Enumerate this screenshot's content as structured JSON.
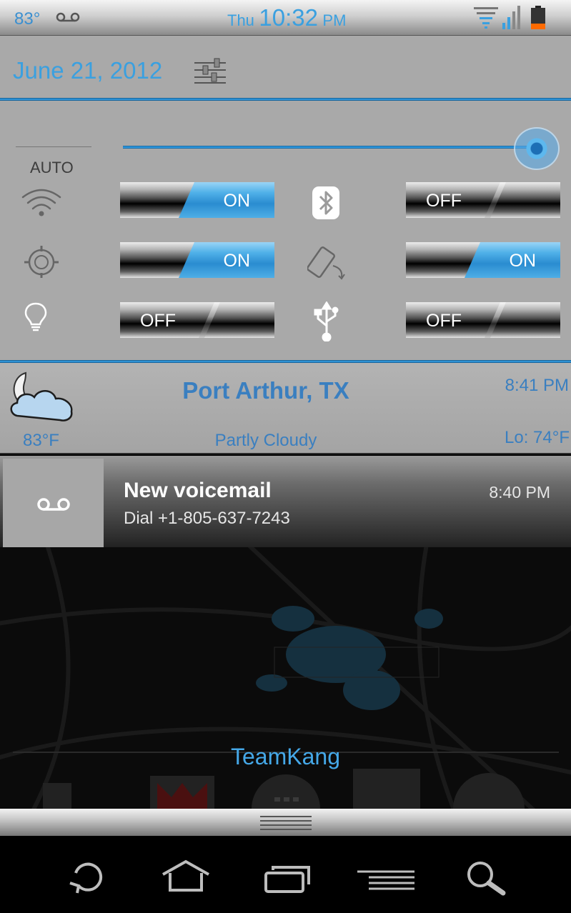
{
  "status_bar": {
    "temperature": "83°",
    "voicemail_icon": "voicemail-icon",
    "clock_day": "Thu",
    "clock_time": "10:32",
    "clock_ampm": "PM",
    "icons": [
      "wifi-icon",
      "signal-icon",
      "battery-icon"
    ],
    "accent_color": "#3aa0e0"
  },
  "header": {
    "date": "June 21, 2012",
    "settings_icon": "settings-sliders-icon"
  },
  "toggles": {
    "auto_label": "AUTO",
    "brightness_level": 1.0,
    "items": [
      {
        "icon": "wifi-icon",
        "label": "ON",
        "state": "on"
      },
      {
        "icon": "bluetooth-icon",
        "label": "OFF",
        "state": "off"
      },
      {
        "icon": "gps-icon",
        "label": "ON",
        "state": "on"
      },
      {
        "icon": "auto-rotate-icon",
        "label": "ON",
        "state": "on"
      },
      {
        "icon": "flashlight-icon",
        "label": "OFF",
        "state": "off"
      },
      {
        "icon": "usb-tether-icon",
        "label": "OFF",
        "state": "off"
      }
    ]
  },
  "weather": {
    "icon": "partly-cloudy-night-icon",
    "city": "Port Arthur, TX",
    "updated": "8:41 PM",
    "temperature": "83°F",
    "condition": "Partly Cloudy",
    "low": "Lo: 74°F"
  },
  "notification": {
    "icon": "voicemail-icon",
    "title": "New voicemail",
    "subtitle": "Dial +1-805-637-7243",
    "time": "8:40 PM"
  },
  "wallpaper": {
    "carrier": "TeamKang"
  },
  "nav_bar": {
    "buttons": [
      "back-icon",
      "home-icon",
      "recent-apps-icon",
      "menu-icon",
      "search-icon"
    ]
  }
}
